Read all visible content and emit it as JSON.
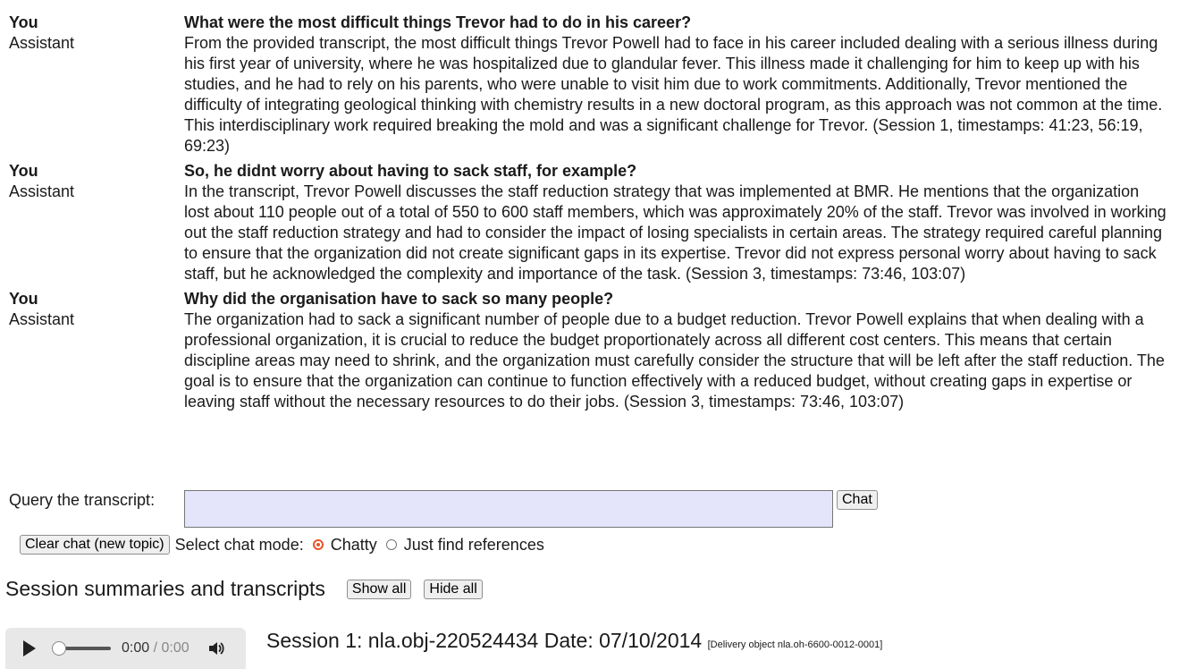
{
  "conversation": [
    {
      "speaker": "You",
      "text": "What were the most difficult things Trevor had to do in his career?"
    },
    {
      "speaker": "Assistant",
      "text": "From the provided transcript, the most difficult things Trevor Powell had to face in his career included dealing with a serious illness during his first year of university, where he was hospitalized due to glandular fever. This illness made it challenging for him to keep up with his studies, and he had to rely on his parents, who were unable to visit him due to work commitments. Additionally, Trevor mentioned the difficulty of integrating geological thinking with chemistry results in a new doctoral program, as this approach was not common at the time. This interdisciplinary work required breaking the mold and was a significant challenge for Trevor. (Session 1, timestamps: 41:23, 56:19, 69:23)"
    },
    {
      "speaker": "You",
      "text": "So, he didnt worry about having to sack staff, for example?"
    },
    {
      "speaker": "Assistant",
      "text": "In the transcript, Trevor Powell discusses the staff reduction strategy that was implemented at BMR. He mentions that the organization lost about 110 people out of a total of 550 to 600 staff members, which was approximately 20% of the staff. Trevor was involved in working out the staff reduction strategy and had to consider the impact of losing specialists in certain areas. The strategy required careful planning to ensure that the organization did not create significant gaps in its expertise. Trevor did not express personal worry about having to sack staff, but he acknowledged the complexity and importance of the task. (Session 3, timestamps: 73:46, 103:07)"
    },
    {
      "speaker": "You",
      "text": "Why did the organisation have to sack so many people?"
    },
    {
      "speaker": "Assistant",
      "text": "The organization had to sack a significant number of people due to a budget reduction. Trevor Powell explains that when dealing with a professional organization, it is crucial to reduce the budget proportionately across all different cost centers. This means that certain discipline areas may need to shrink, and the organization must carefully consider the structure that will be left after the staff reduction. The goal is to ensure that the organization can continue to function effectively with a reduced budget, without creating gaps in expertise or leaving staff without the necessary resources to do their jobs. (Session 3, timestamps: 73:46, 103:07)"
    }
  ],
  "query": {
    "label": "Query the transcript:",
    "value": "",
    "chat_button": "Chat"
  },
  "controls": {
    "clear_button": "Clear chat (new topic)",
    "mode_label": "Select chat mode:",
    "modes": [
      {
        "label": "Chatty",
        "selected": true
      },
      {
        "label": "Just find references",
        "selected": false
      }
    ],
    "accent_color": "#e8542a"
  },
  "sessions": {
    "heading": "Session summaries and transcripts",
    "show_all": "Show all",
    "hide_all": "Hide all",
    "player": {
      "current_time": "0:00",
      "separator": " / ",
      "duration": "0:00",
      "progress": 0
    },
    "session_title": "Session 1: nla.obj-220524434 Date: 07/10/2014",
    "delivery_note": "[Delivery object nla.oh-6600-0012-0001]"
  }
}
